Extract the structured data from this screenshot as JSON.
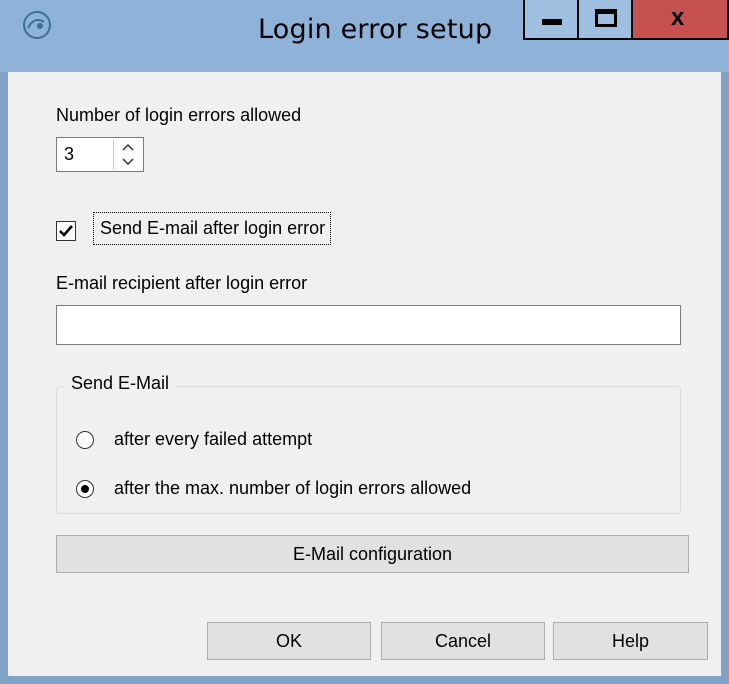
{
  "window": {
    "title": "Login error setup",
    "controls": {
      "minimize": "minimize",
      "maximize": "maximize",
      "close": "x"
    }
  },
  "login_errors": {
    "label": "Number of login errors allowed",
    "value": "3"
  },
  "send_email_checkbox": {
    "label": "Send E-mail after login error",
    "checked": true
  },
  "recipient": {
    "label": "E-mail recipient after login error",
    "value": ""
  },
  "send_mail_group": {
    "legend": "Send E-Mail",
    "options": [
      {
        "label": "after every failed attempt",
        "selected": false
      },
      {
        "label": "after the max. number of login errors allowed",
        "selected": true
      }
    ]
  },
  "buttons": {
    "email_config": "E-Mail configuration",
    "ok": "OK",
    "cancel": "Cancel",
    "help": "Help"
  },
  "icons": {
    "app": "app-logo-icon",
    "spin_up": "chevron-up-icon",
    "spin_down": "chevron-down-icon",
    "check": "checkmark-icon"
  },
  "colors": {
    "titlebar": "#8fb3d8",
    "close_button": "#c75050",
    "dialog_bg": "#f0f0f0"
  }
}
